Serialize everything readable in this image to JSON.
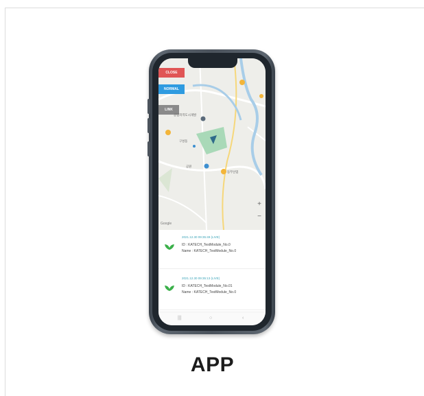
{
  "map": {
    "buttons": {
      "close": "CLOSE",
      "normal": "NORMAL",
      "link": "LINK"
    },
    "zoom_in": "+",
    "zoom_out": "−",
    "google": "Google",
    "labels": [
      "공업지역도시개발",
      "구성동",
      "공원",
      "동부산업"
    ]
  },
  "list": {
    "items": [
      {
        "date": "2021.12.30 09:35:49 (LIVE)",
        "id": "ID : KATECH_TestModule_No.0",
        "name": "Name : KATECH_TestModule_No.0"
      },
      {
        "date": "2021.12.30 09:35:13 (LIVE)",
        "id": "ID : KATECH_TestModule_No.01",
        "name": "Name : KATECH_TestModule_No.0"
      }
    ]
  },
  "nav": {
    "menu_icon": "menu-icon",
    "home_icon": "home-icon",
    "back_icon": "back-icon"
  },
  "caption": "APP",
  "colors": {
    "close_btn": "#e05555",
    "normal_btn": "#2f9be0",
    "link_btn": "#8a8a8a",
    "accent_text": "#3aa4b8",
    "marker": "#f3b53a",
    "leaf": "#3bb04a"
  }
}
